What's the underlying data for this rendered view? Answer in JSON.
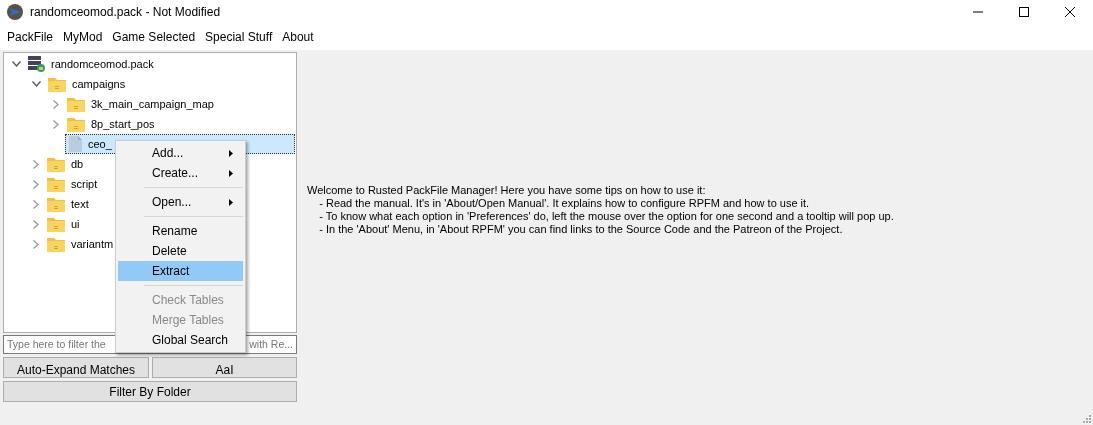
{
  "window": {
    "title": "randomceomod.pack - Not Modified"
  },
  "menu_bar": [
    "PackFile",
    "MyMod",
    "Game Selected",
    "Special Stuff",
    "About"
  ],
  "tree": [
    {
      "label": "randomceomod.pack",
      "kind": "pack",
      "expanded": true,
      "children": [
        {
          "label": "campaigns",
          "kind": "folder",
          "expanded": true,
          "children": [
            {
              "label": "3k_main_campaign_map",
              "kind": "folder",
              "expanded": false
            },
            {
              "label": "8p_start_pos",
              "kind": "folder",
              "expanded": false
            },
            {
              "label": "ceo_",
              "kind": "file",
              "selected": true
            }
          ]
        },
        {
          "label": "db",
          "kind": "folder",
          "expanded": false
        },
        {
          "label": "script",
          "kind": "folder",
          "expanded": false
        },
        {
          "label": "text",
          "kind": "folder",
          "expanded": false
        },
        {
          "label": "ui",
          "kind": "folder",
          "expanded": false
        },
        {
          "label": "variantm",
          "kind": "folder",
          "expanded": false
        }
      ]
    }
  ],
  "filter": {
    "placeholder_start": "Type here to filter the",
    "placeholder_end": "with Re..."
  },
  "buttons": [
    {
      "label": "Auto-Expand Matches"
    },
    {
      "label": "AaI"
    }
  ],
  "filter_button": "Filter By Folder",
  "welcome": {
    "heading": "Welcome to Rusted PackFile Manager! Here you have some tips on how to use it:",
    "tips": [
      "- Read the manual. It's in 'About/Open Manual'. It explains how to configure RPFM and how to use it.",
      "- To know what each option in 'Preferences' do, left the mouse over the option for one second and a tooltip will pop up.",
      "- In the 'About' Menu, in 'About RPFM' you can find links to the Source Code and the Patreon of the Project."
    ]
  },
  "context_menu": [
    {
      "kind": "item",
      "label": "Add...",
      "submenu": true,
      "disabled": false,
      "selected": false
    },
    {
      "kind": "item",
      "label": "Create...",
      "submenu": true,
      "disabled": false,
      "selected": false
    },
    {
      "kind": "separator"
    },
    {
      "kind": "item",
      "label": "Open...",
      "submenu": true,
      "disabled": false,
      "selected": false
    },
    {
      "kind": "separator"
    },
    {
      "kind": "item",
      "label": "Rename",
      "submenu": false,
      "disabled": false,
      "selected": false
    },
    {
      "kind": "item",
      "label": "Delete",
      "submenu": false,
      "disabled": false,
      "selected": false
    },
    {
      "kind": "item",
      "label": "Extract",
      "submenu": false,
      "disabled": false,
      "selected": true
    },
    {
      "kind": "separator"
    },
    {
      "kind": "item",
      "label": "Check Tables",
      "submenu": false,
      "disabled": true,
      "selected": false
    },
    {
      "kind": "item",
      "label": "Merge Tables",
      "submenu": false,
      "disabled": true,
      "selected": false
    },
    {
      "kind": "item",
      "label": "Global Search",
      "submenu": false,
      "disabled": false,
      "selected": false
    }
  ]
}
